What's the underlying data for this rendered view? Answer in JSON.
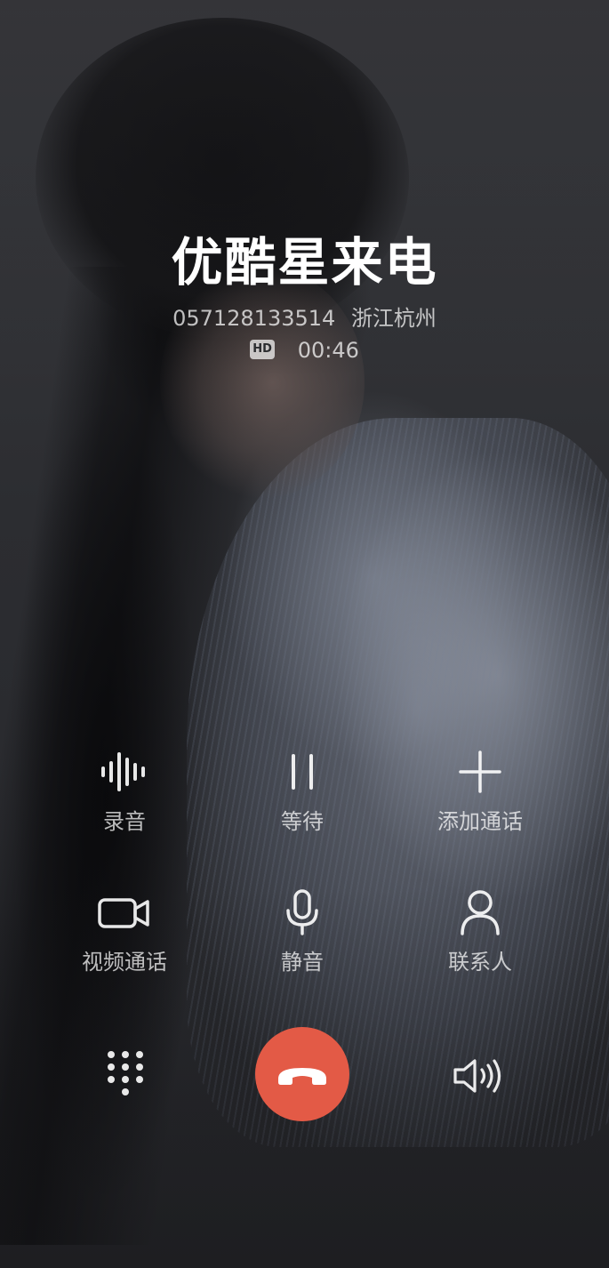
{
  "caller": {
    "name": "优酷星来电",
    "number": "057128133514",
    "location": "浙江杭州",
    "hd_badge": "HD",
    "duration": "00:46"
  },
  "controls": {
    "record": {
      "label": "录音",
      "icon": "waveform-icon"
    },
    "hold": {
      "label": "等待",
      "icon": "pause-icon"
    },
    "add_call": {
      "label": "添加通话",
      "icon": "plus-icon"
    },
    "video_call": {
      "label": "视频通话",
      "icon": "video-camera-icon"
    },
    "mute": {
      "label": "静音",
      "icon": "microphone-icon"
    },
    "contacts": {
      "label": "联系人",
      "icon": "person-icon"
    }
  },
  "bottom_bar": {
    "dialpad_icon": "dialpad-icon",
    "hangup_icon": "phone-hangup-icon",
    "speaker_icon": "speaker-icon"
  },
  "colors": {
    "hangup": "#e35a46",
    "text_primary": "#ffffff"
  }
}
